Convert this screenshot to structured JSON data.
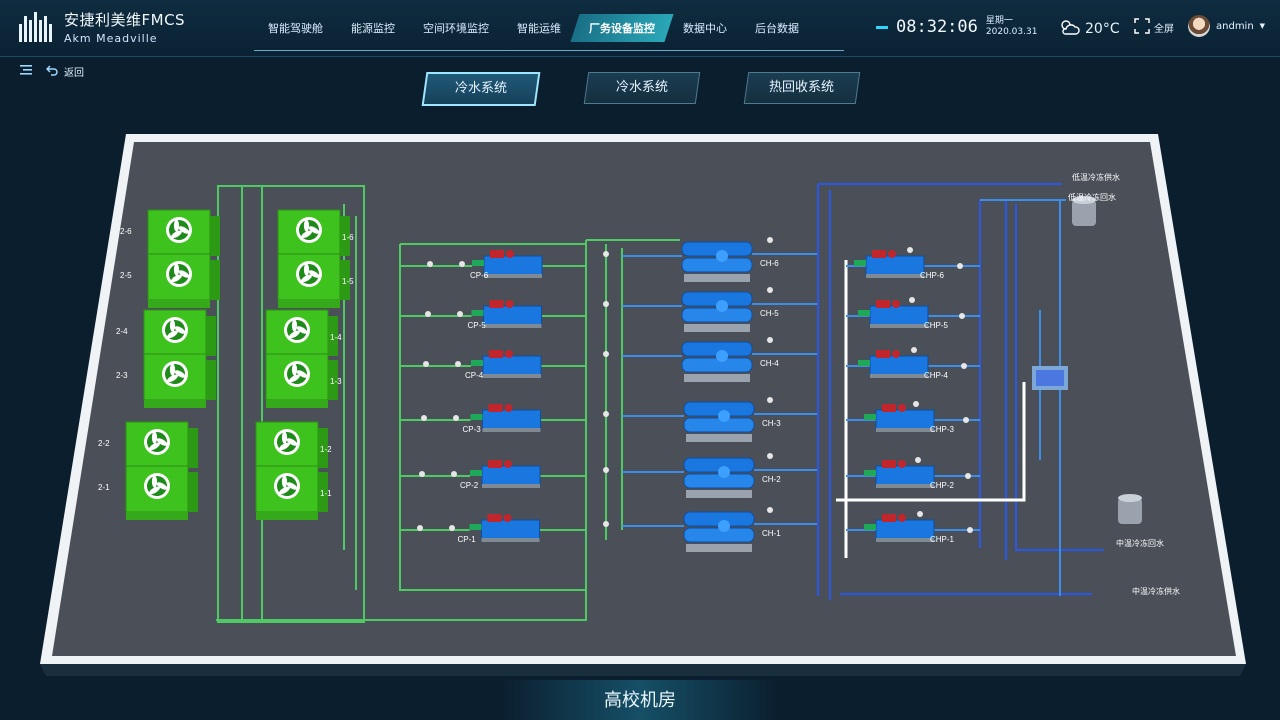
{
  "app": {
    "title_cn": "安捷利美维FMCS",
    "title_en": "Akm Meadville"
  },
  "nav": {
    "items": [
      "智能驾驶舱",
      "能源监控",
      "空间环境监控",
      "智能运维",
      "厂务设备监控",
      "数据中心",
      "后台数据"
    ],
    "active": "厂务设备监控"
  },
  "clock": {
    "time": "08:32:06",
    "weekday": "星期一",
    "date": "2020.03.31"
  },
  "weather": {
    "temp": "20°C",
    "icon": "cloud-sun-icon"
  },
  "fullscreen_label": "全屏",
  "user": {
    "name": "andmin"
  },
  "back_label": "返回",
  "tabs": [
    {
      "label": "冷水系统",
      "active": true
    },
    {
      "label": "冷水系统",
      "active": false
    },
    {
      "label": "热回收系统",
      "active": false
    }
  ],
  "diagram": {
    "towers_left": [
      "2-6",
      "2-5",
      "2-4",
      "2-3",
      "2-2",
      "2-1"
    ],
    "towers_right": [
      "1-6",
      "1-5",
      "1-4",
      "1-3",
      "1-2",
      "1-1"
    ],
    "pumps": [
      "CP-6",
      "CP-5",
      "CP-4",
      "CP-3",
      "CP-2",
      "CP-1"
    ],
    "chillers": [
      "CH-6",
      "CH-5",
      "CH-4",
      "CH-3",
      "CH-2",
      "CH-1"
    ],
    "chp": [
      "CHP-6",
      "CHP-5",
      "CHP-4",
      "CHP-3",
      "CHP-2",
      "CHP-1"
    ],
    "outlets": {
      "low_supply": "低温冷冻供水",
      "low_return": "低温冷冻回水",
      "mid_return": "中温冷冻回水",
      "mid_supply": "中温冷冻供水"
    }
  },
  "footer": {
    "title": "高校机房"
  },
  "colors": {
    "tower_green": "#3ec21e",
    "pump_blue": "#1b77e0",
    "pipe_green": "#4fc964",
    "pipe_blue": "#2a58e6",
    "floor": "#4b5058"
  }
}
